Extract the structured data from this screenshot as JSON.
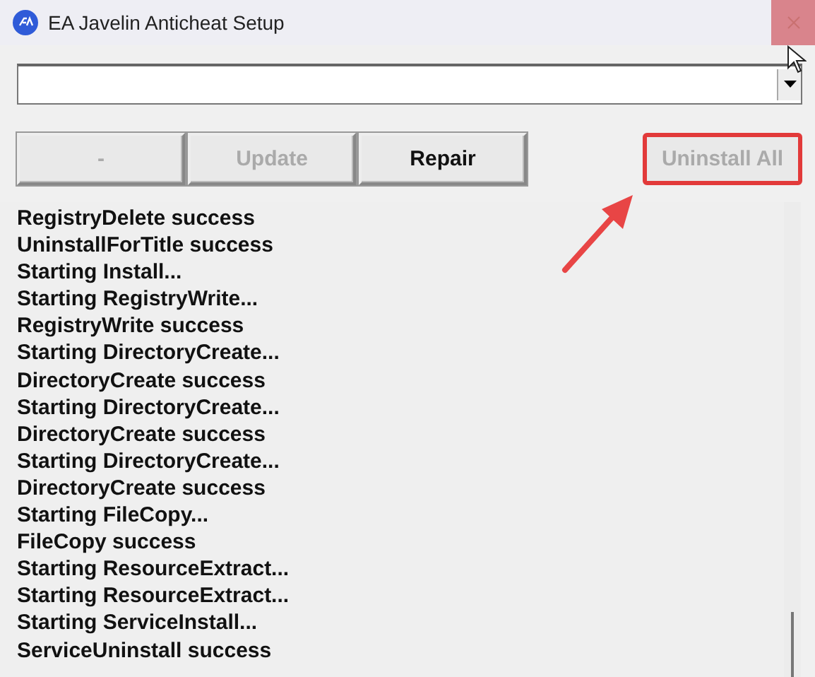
{
  "window": {
    "title": "EA Javelin Anticheat Setup"
  },
  "buttons": [
    {
      "label": "-",
      "disabled": true,
      "highlighted": false
    },
    {
      "label": "Update",
      "disabled": true,
      "highlighted": false
    },
    {
      "label": "Repair",
      "disabled": false,
      "highlighted": false
    },
    {
      "label": "Uninstall All",
      "disabled": true,
      "highlighted": true
    }
  ],
  "log": [
    "RegistryDelete success",
    "UninstallForTitle success",
    "Starting Install...",
    "Starting RegistryWrite...",
    "RegistryWrite success",
    "Starting DirectoryCreate...",
    "DirectoryCreate success",
    "Starting DirectoryCreate...",
    "DirectoryCreate success",
    "Starting DirectoryCreate...",
    "DirectoryCreate success",
    "Starting FileCopy...",
    "FileCopy success",
    "Starting ResourceExtract...",
    "Starting ResourceExtract...",
    "Starting ServiceInstall...",
    "ServiceUninstall success"
  ]
}
